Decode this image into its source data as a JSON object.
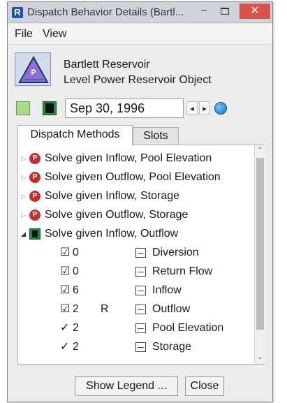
{
  "window": {
    "title": "Dispatch Behavior Details (Bartl...",
    "minimize": "–",
    "close": "✕"
  },
  "menu": [
    "File",
    "View"
  ],
  "object": {
    "name": "Bartlett Reservoir",
    "type": "Level Power Reservoir Object",
    "icon_letter": "P"
  },
  "date": {
    "value": "Sep 30, 1996",
    "prev": "◂",
    "next": "▸"
  },
  "tabs": {
    "dispatch_methods": "Dispatch Methods",
    "slots": "Slots"
  },
  "methods": [
    {
      "label": "Solve given Inflow, Pool Elevation",
      "icon": "red-solver-icon",
      "expanded": false
    },
    {
      "label": "Solve given Outflow, Pool Elevation",
      "icon": "red-solver-icon",
      "expanded": false
    },
    {
      "label": "Solve given Inflow, Storage",
      "icon": "red-solver-icon",
      "expanded": false
    },
    {
      "label": "Solve given Outflow, Storage",
      "icon": "red-solver-icon",
      "expanded": false
    },
    {
      "label": "Solve given Inflow, Outflow",
      "icon": "green-solver-icon",
      "expanded": true
    }
  ],
  "expanders": {
    "collapsed": "▷",
    "expanded": "◢"
  },
  "slots": [
    {
      "check": "☑",
      "level": "0",
      "flag": "",
      "name": "Diversion"
    },
    {
      "check": "☑",
      "level": "0",
      "flag": "",
      "name": "Return Flow"
    },
    {
      "check": "☑",
      "level": "6",
      "flag": "",
      "name": "Inflow"
    },
    {
      "check": "☑",
      "level": "2",
      "flag": "R",
      "name": "Outflow"
    },
    {
      "check": "✓",
      "level": "2",
      "flag": "",
      "name": "Pool Elevation"
    },
    {
      "check": "✓",
      "level": "2",
      "flag": "",
      "name": "Storage"
    }
  ],
  "method_icon_letter": "P",
  "scroll": {
    "up": "⌃",
    "down": "⌄"
  },
  "buttons": {
    "show_legend": "Show Legend ...",
    "close": "Close"
  },
  "colors": {
    "titlebar": "#cfd4dc",
    "close_button": "#d9534a",
    "red_icon": "#c62d2d",
    "green_icon": "#1f8a3a"
  }
}
